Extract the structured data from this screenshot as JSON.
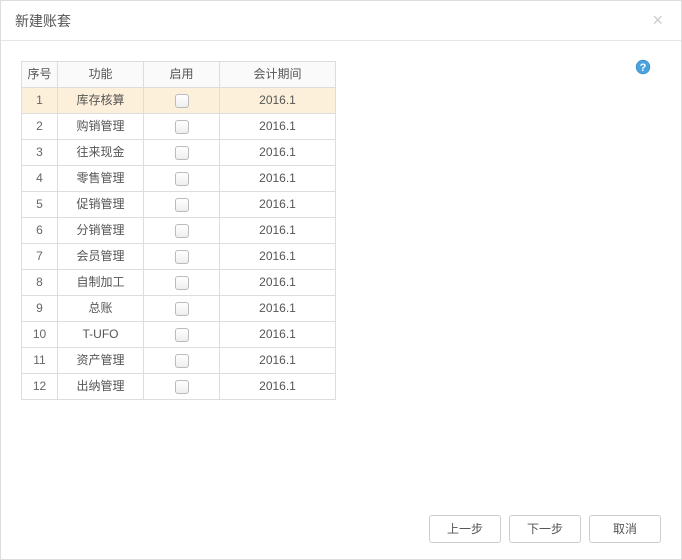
{
  "dialog": {
    "title": "新建账套",
    "close": "×"
  },
  "table": {
    "headers": {
      "seq": "序号",
      "func": "功能",
      "enable": "启用",
      "period": "会计期间"
    },
    "rows": [
      {
        "seq": "1",
        "func": "库存核算",
        "period": "2016.1",
        "selected": true
      },
      {
        "seq": "2",
        "func": "购销管理",
        "period": "2016.1"
      },
      {
        "seq": "3",
        "func": "往来现金",
        "period": "2016.1"
      },
      {
        "seq": "4",
        "func": "零售管理",
        "period": "2016.1"
      },
      {
        "seq": "5",
        "func": "促销管理",
        "period": "2016.1"
      },
      {
        "seq": "6",
        "func": "分销管理",
        "period": "2016.1"
      },
      {
        "seq": "7",
        "func": "会员管理",
        "period": "2016.1"
      },
      {
        "seq": "8",
        "func": "自制加工",
        "period": "2016.1"
      },
      {
        "seq": "9",
        "func": "总账",
        "period": "2016.1"
      },
      {
        "seq": "10",
        "func": "T-UFO",
        "period": "2016.1"
      },
      {
        "seq": "11",
        "func": "资产管理",
        "period": "2016.1"
      },
      {
        "seq": "12",
        "func": "出纳管理",
        "period": "2016.1"
      }
    ]
  },
  "footer": {
    "prev": "上一步",
    "next": "下一步",
    "cancel": "取消"
  }
}
